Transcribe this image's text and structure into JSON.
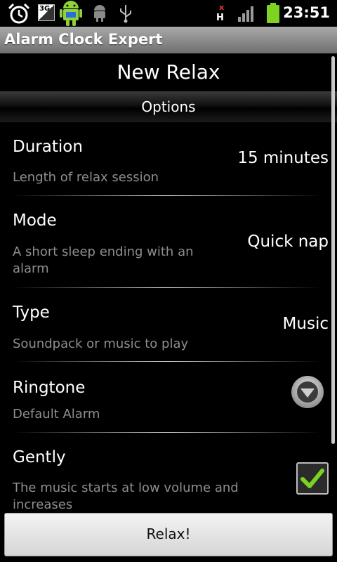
{
  "status_bar": {
    "time": "23:51",
    "network_label": "3G",
    "icons": [
      "alarm-clock-icon",
      "signal-3g-icon",
      "android-notification-icon",
      "usb-debugging-icon",
      "usb-icon",
      "hspa-icon",
      "signal-strength-icon",
      "battery-icon"
    ]
  },
  "app": {
    "title": "Alarm Clock Expert"
  },
  "page": {
    "heading": "New Relax",
    "section": "Options"
  },
  "rows": [
    {
      "title": "Duration",
      "summary": "Length of relax session",
      "value": "15 minutes"
    },
    {
      "title": "Mode",
      "summary": "A short sleep ending with an alarm",
      "value": "Quick nap"
    },
    {
      "title": "Type",
      "summary": "Soundpack or music to play",
      "value": "Music"
    },
    {
      "title": "Ringtone",
      "summary": "Default Alarm",
      "value": ""
    },
    {
      "title": "Gently",
      "summary": "The music starts at low volume and increases",
      "checked": true
    }
  ],
  "button": {
    "label": "Relax!"
  },
  "colors": {
    "accent_green": "#7bd321",
    "summary_gray": "#8e8e8e",
    "battery_green": "#7ed321"
  }
}
